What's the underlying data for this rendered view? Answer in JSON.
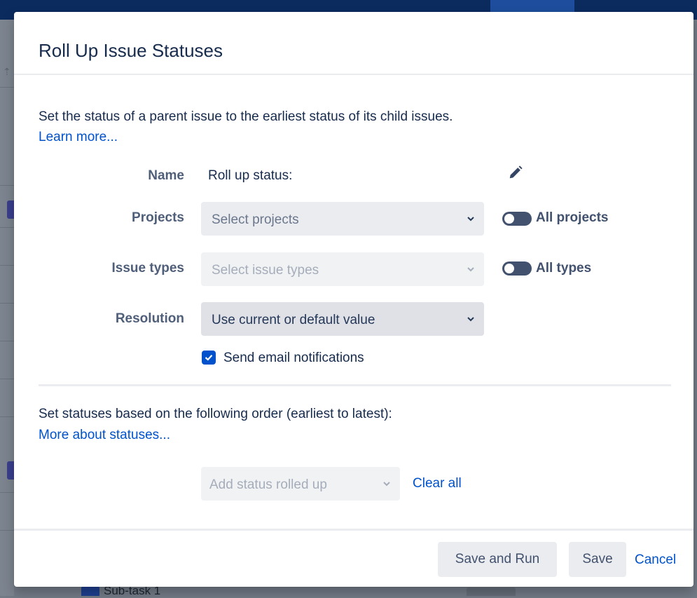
{
  "dialog": {
    "title": "Roll Up Issue Statuses",
    "intro_text": "Set the status of a parent issue to the earliest status of its child issues.",
    "learn_more": "Learn more..."
  },
  "form": {
    "name": {
      "label": "Name",
      "value": "Roll up status:",
      "edit_icon": "pencil-icon"
    },
    "projects": {
      "label": "Projects",
      "placeholder": "Select projects",
      "toggle_label": "All projects",
      "toggle_on": false
    },
    "issue_types": {
      "label": "Issue types",
      "placeholder": "Select issue types",
      "disabled": true,
      "toggle_label": "All types",
      "toggle_on": false
    },
    "resolution": {
      "label": "Resolution",
      "value": "Use current or default value"
    },
    "send_email": {
      "label": "Send email notifications",
      "checked": true
    }
  },
  "statuses": {
    "order_text": "Set statuses based on the following order (earliest to latest):",
    "more_link": "More about statuses...",
    "add_placeholder": "Add status rolled up",
    "clear_all": "Clear all"
  },
  "footer": {
    "save_and_run": "Save and Run",
    "save": "Save",
    "cancel": "Cancel"
  },
  "background": {
    "subtask_text": "Sub-task 1"
  },
  "colors": {
    "link": "#0052cc",
    "text": "#172b4d",
    "label": "#505f79",
    "checkbox": "#0052cc",
    "toggle_off": "#42526e"
  }
}
